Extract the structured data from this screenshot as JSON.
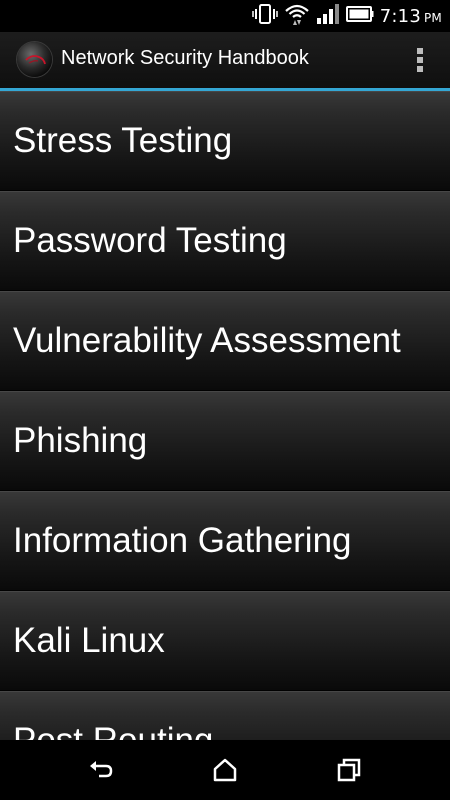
{
  "status_bar": {
    "time": "7:13",
    "ampm": "PM",
    "icons": [
      "vibrate-icon",
      "wifi-icon",
      "signal-icon",
      "battery-icon"
    ]
  },
  "action_bar": {
    "title": "Network Security Handbook",
    "accent_color": "#34a7d4",
    "overflow_icon": "overflow-menu-icon"
  },
  "menu": {
    "items": [
      {
        "label": "Stress Testing"
      },
      {
        "label": "Password Testing"
      },
      {
        "label": "Vulnerability Assessment"
      },
      {
        "label": "Phishing"
      },
      {
        "label": "Information Gathering"
      },
      {
        "label": "Kali Linux"
      },
      {
        "label": "Post Routing"
      }
    ]
  },
  "nav_bar": {
    "buttons": [
      "back-icon",
      "home-icon",
      "recents-icon"
    ]
  }
}
